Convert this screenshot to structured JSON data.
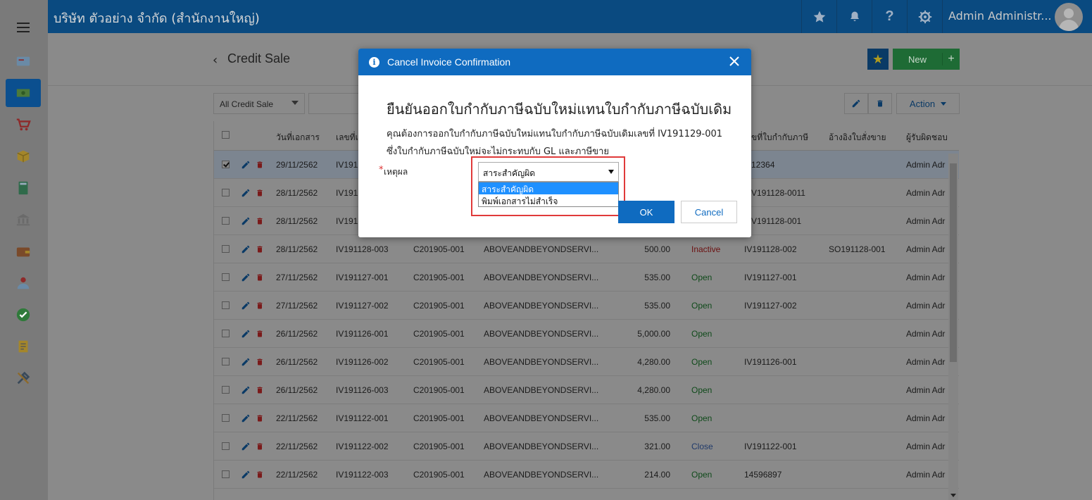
{
  "app": {
    "company": "บริษัท ตัวอย่าง จำกัด (สำนักงานใหญ่)",
    "user": "Admin Administr..."
  },
  "header_icons": [
    "star-icon",
    "bell-icon",
    "help-icon",
    "gear-icon"
  ],
  "sidebar": {
    "items": [
      {
        "name": "sidebar-item-dashboard",
        "icon": "card-icon",
        "active": false
      },
      {
        "name": "sidebar-item-sales",
        "icon": "money-icon",
        "active": true
      },
      {
        "name": "sidebar-item-purchase",
        "icon": "cart-icon",
        "active": false
      },
      {
        "name": "sidebar-item-inventory",
        "icon": "box-icon",
        "active": false
      },
      {
        "name": "sidebar-item-accounting",
        "icon": "book-icon",
        "active": false
      },
      {
        "name": "sidebar-item-bank",
        "icon": "bank-icon",
        "active": false
      },
      {
        "name": "sidebar-item-wallet",
        "icon": "wallet-icon",
        "active": false
      },
      {
        "name": "sidebar-item-contacts",
        "icon": "person-icon",
        "active": false
      },
      {
        "name": "sidebar-item-approve",
        "icon": "check-icon",
        "active": false
      },
      {
        "name": "sidebar-item-reports",
        "icon": "report-icon",
        "active": false
      },
      {
        "name": "sidebar-item-settings",
        "icon": "tools-icon",
        "active": false
      }
    ]
  },
  "page": {
    "title": "Credit Sale",
    "new_label": "New",
    "filter": "All Credit Sale",
    "action_label": "Action"
  },
  "table": {
    "headers": [
      "วันที่เอกสาร",
      "เลขที่เ",
      "ขที่ใบกำกับภาษี",
      "อ้างอิงใบสั่งขาย",
      "ผู้รับผิดชอบ"
    ],
    "rows": [
      {
        "date": "29/11/2562",
        "doc": "IV191",
        "cust": "",
        "name": "",
        "amount": "",
        "status": "",
        "status_class": "",
        "tax": "12364",
        "so": "",
        "owner": "Admin Adr",
        "selected": true
      },
      {
        "date": "28/11/2562",
        "doc": "IV191",
        "cust": "",
        "name": "",
        "amount": "",
        "status": "",
        "status_class": "",
        "tax": "V191128-0011",
        "so": "",
        "owner": "Admin Adr",
        "selected": false
      },
      {
        "date": "28/11/2562",
        "doc": "IV191",
        "cust": "",
        "name": "",
        "amount": "",
        "status": "",
        "status_class": "",
        "tax": "V191128-001",
        "so": "",
        "owner": "Admin Adr",
        "selected": false
      },
      {
        "date": "28/11/2562",
        "doc": "IV191128-003",
        "cust": "C201905-001",
        "name": "ABOVEANDBEYONDSERVI...",
        "amount": "500.00",
        "status": "Inactive",
        "status_class": "status-inactive",
        "tax": "IV191128-002",
        "so": "SO191128-001",
        "owner": "Admin Adr",
        "selected": false
      },
      {
        "date": "27/11/2562",
        "doc": "IV191127-001",
        "cust": "C201905-001",
        "name": "ABOVEANDBEYONDSERVI...",
        "amount": "535.00",
        "status": "Open",
        "status_class": "status-open",
        "tax": "IV191127-001",
        "so": "",
        "owner": "Admin Adr",
        "selected": false
      },
      {
        "date": "27/11/2562",
        "doc": "IV191127-002",
        "cust": "C201905-001",
        "name": "ABOVEANDBEYONDSERVI...",
        "amount": "535.00",
        "status": "Open",
        "status_class": "status-open",
        "tax": "IV191127-002",
        "so": "",
        "owner": "Admin Adr",
        "selected": false
      },
      {
        "date": "26/11/2562",
        "doc": "IV191126-001",
        "cust": "C201905-001",
        "name": "ABOVEANDBEYONDSERVI...",
        "amount": "5,000.00",
        "status": "Open",
        "status_class": "status-open",
        "tax": "",
        "so": "",
        "owner": "Admin Adr",
        "selected": false
      },
      {
        "date": "26/11/2562",
        "doc": "IV191126-002",
        "cust": "C201905-001",
        "name": "ABOVEANDBEYONDSERVI...",
        "amount": "4,280.00",
        "status": "Open",
        "status_class": "status-open",
        "tax": "IV191126-001",
        "so": "",
        "owner": "Admin Adr",
        "selected": false
      },
      {
        "date": "26/11/2562",
        "doc": "IV191126-003",
        "cust": "C201905-001",
        "name": "ABOVEANDBEYONDSERVI...",
        "amount": "4,280.00",
        "status": "Open",
        "status_class": "status-open",
        "tax": "",
        "so": "",
        "owner": "Admin Adr",
        "selected": false
      },
      {
        "date": "22/11/2562",
        "doc": "IV191122-001",
        "cust": "C201905-001",
        "name": "ABOVEANDBEYONDSERVI...",
        "amount": "535.00",
        "status": "Open",
        "status_class": "status-open",
        "tax": "",
        "so": "",
        "owner": "Admin Adr",
        "selected": false
      },
      {
        "date": "22/11/2562",
        "doc": "IV191122-002",
        "cust": "C201905-001",
        "name": "ABOVEANDBEYONDSERVI...",
        "amount": "321.00",
        "status": "Close",
        "status_class": "status-close",
        "tax": "IV191122-001",
        "so": "",
        "owner": "Admin Adr",
        "selected": false
      },
      {
        "date": "22/11/2562",
        "doc": "IV191122-003",
        "cust": "C201905-001",
        "name": "ABOVEANDBEYONDSERVI...",
        "amount": "214.00",
        "status": "Open",
        "status_class": "status-open",
        "tax": "14596897",
        "so": "",
        "owner": "Admin Adr",
        "selected": false
      }
    ]
  },
  "modal": {
    "title": "Cancel Invoice Confirmation",
    "heading": "ยืนยันออกใบกำกับภาษีฉบับใหม่แทนใบกำกับภาษีฉบับเดิม",
    "text1": "คุณต้องการออกใบกำกับภาษีฉบับใหม่แทนใบกำกับภาษีฉบับเดิมเลขที่ IV191129-001",
    "text2": "ซึ่งใบกำกับภาษีฉบับใหม่จะไม่กระทบกับ GL และภาษีขาย",
    "required_mark": "*",
    "reason_label": "เหตุผล",
    "reason_value": "สาระสำคัญผิด",
    "reason_options": [
      "สาระสำคัญผิด",
      "พิมพ์เอกสารไม่สำเร็จ"
    ],
    "ok_label": "OK",
    "cancel_label": "Cancel"
  },
  "colors": {
    "header": "#0a4a80",
    "modal_header": "#0f6bc0",
    "new_button": "#1e6b35",
    "highlight_box": "#e03a3a"
  }
}
